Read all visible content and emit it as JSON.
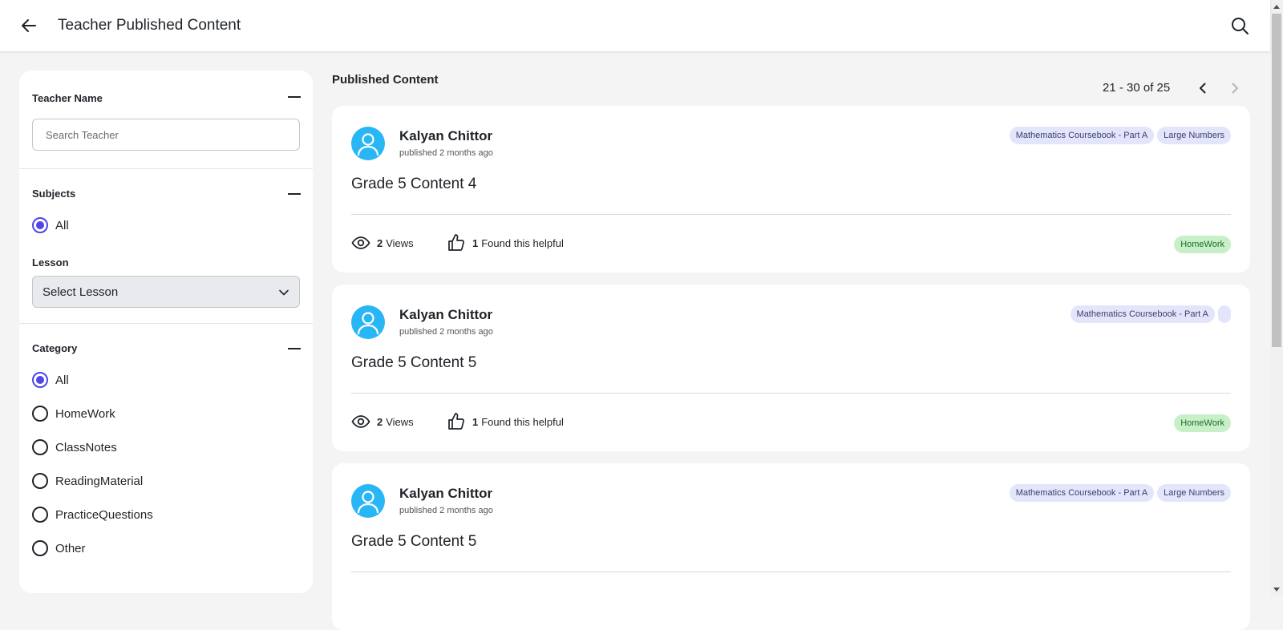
{
  "header": {
    "title": "Teacher Published Content"
  },
  "sidebar": {
    "teacher": {
      "title": "Teacher Name",
      "placeholder": "Search Teacher",
      "value": ""
    },
    "subjects": {
      "title": "Subjects",
      "options": [
        "All"
      ],
      "selected": "All"
    },
    "lesson": {
      "label": "Lesson",
      "selected": "Select Lesson"
    },
    "category": {
      "title": "Category",
      "options": [
        "All",
        "HomeWork",
        "ClassNotes",
        "ReadingMaterial",
        "PracticeQuestions",
        "Other"
      ],
      "selected": "All"
    }
  },
  "main": {
    "title": "Published Content",
    "pagination": {
      "range": "21 - 30 of 25"
    },
    "cards": [
      {
        "author": "Kalyan Chittor",
        "published": "published 2 months ago",
        "tags": [
          "Mathematics Coursebook - Part A",
          "Large Numbers"
        ],
        "title": "Grade 5 Content 4",
        "views_count": "2",
        "views_label": "Views",
        "helpful_count": "1",
        "helpful_label": "Found this helpful",
        "category": "HomeWork"
      },
      {
        "author": "Kalyan Chittor",
        "published": "published 2 months ago",
        "tags": [
          "Mathematics Coursebook - Part A",
          ""
        ],
        "title": "Grade 5 Content 5",
        "views_count": "2",
        "views_label": "Views",
        "helpful_count": "1",
        "helpful_label": "Found this helpful",
        "category": "HomeWork"
      },
      {
        "author": "Kalyan Chittor",
        "published": "published 2 months ago",
        "tags": [
          "Mathematics Coursebook - Part A",
          "Large Numbers"
        ],
        "title": "Grade 5 Content 5",
        "views_count": "",
        "views_label": "",
        "helpful_count": "",
        "helpful_label": "",
        "category": ""
      }
    ]
  },
  "colors": {
    "accent": "#4f46e5",
    "avatar": "#29b6f6",
    "subject_tag_bg": "#e3e6fb",
    "category_badge_bg": "#c8f0c8"
  },
  "icons": [
    "back-arrow-icon",
    "search-icon",
    "minus-icon",
    "chevron-down-icon",
    "chevron-left-icon",
    "chevron-right-icon",
    "user-avatar-icon",
    "eye-icon",
    "thumbs-up-icon"
  ]
}
